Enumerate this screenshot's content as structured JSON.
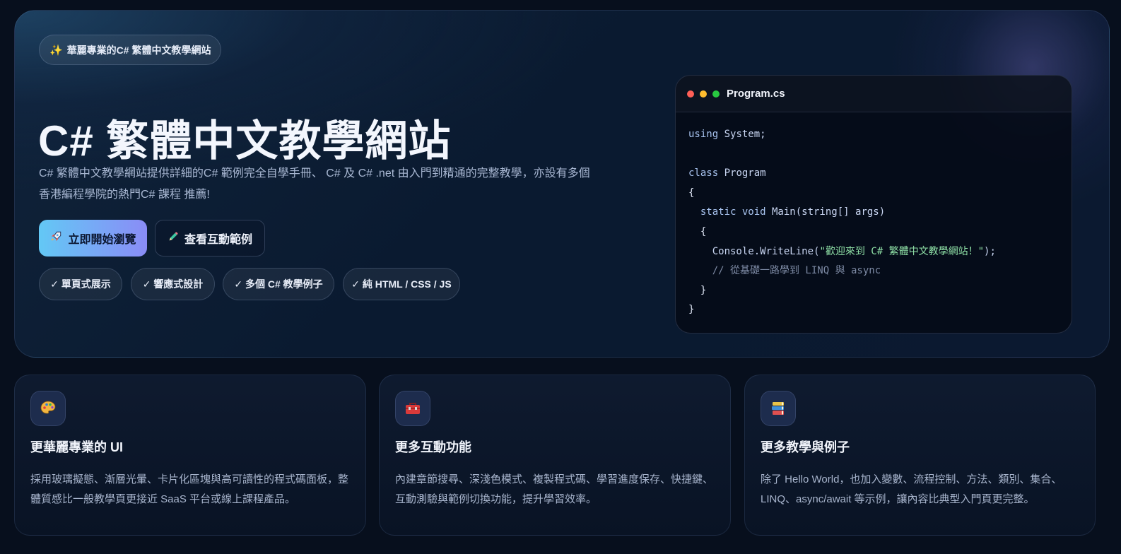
{
  "hero": {
    "badge_icon": "sparkles-icon",
    "badge": "華麗專業的C# 繁體中文教學網站",
    "title": "C# 繁體中文教學網站",
    "description": "C# 繁體中文教學網站提供詳細的C# 範例完全自學手冊、 C# 及 C# .net 由入門到精通的完整教學，亦設有多個香港編程學院的熱門C# 課程 推薦!",
    "primary_button": {
      "icon": "rocket-icon",
      "label": "立即開始瀏覽"
    },
    "secondary_button": {
      "icon": "pencil-icon",
      "label": "查看互動範例"
    },
    "chips": [
      "✓ 單頁式展示",
      "✓ 響應式設計",
      "✓ 多個 C# 教學例子",
      "✓ 純 HTML / CSS / JS"
    ]
  },
  "code_window": {
    "filename": "Program.cs",
    "lines": {
      "l1_kw": "using",
      "l1_rest": " System;",
      "l3_kw": "class",
      "l3_rest": " Program",
      "l4": "{",
      "l5_a": "  static void",
      "l5_b": " Main(string[] args)",
      "l6": "  {",
      "l7_a": "    Console.WriteLine(",
      "l7_str": "\"歡迎來到 C# 繁體中文教學網站！\"",
      "l7_b": ");",
      "l8": "    // 從基礎一路學到 LINQ 與 async",
      "l9": "  }",
      "l10": "}"
    }
  },
  "features": [
    {
      "icon": "palette-icon",
      "title": "更華麗專業的 UI",
      "text": "採用玻璃擬態、漸層光暈、卡片化區塊與高可讀性的程式碼面板，整體質感比一般教學頁更接近 SaaS 平台或線上課程產品。"
    },
    {
      "icon": "toolbox-icon",
      "title": "更多互動功能",
      "text": "內建章節搜尋、深淺色模式、複製程式碼、學習進度保存、快捷鍵、互動測驗與範例切換功能，提升學習效率。"
    },
    {
      "icon": "books-icon",
      "title": "更多教學與例子",
      "text": "除了 Hello World，也加入變數、流程控制、方法、類別、集合、LINQ、async/await 等示例，讓內容比典型入門頁更完整。"
    }
  ],
  "colors": {
    "background": "#070f1d",
    "accent_start": "#63c8f5",
    "accent_end": "#8a8cf6",
    "code_string": "#8fe0a6"
  }
}
